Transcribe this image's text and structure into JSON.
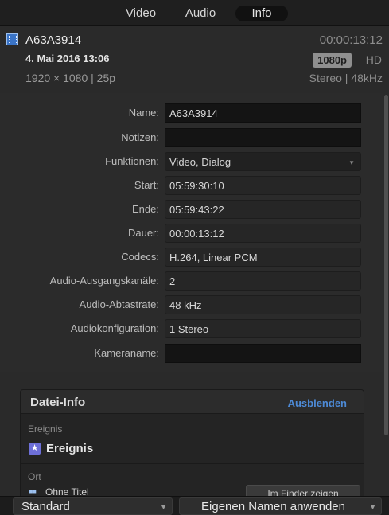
{
  "tabs": [
    {
      "label": "Video",
      "active": false
    },
    {
      "label": "Audio",
      "active": false
    },
    {
      "label": "Info",
      "active": true
    }
  ],
  "clip": {
    "name": "A63A3914",
    "date": "4. Mai 2016 13:06",
    "resolution": "1920 × 1080 | 25p",
    "timecode": "00:00:13:12",
    "format_badge": "1080p",
    "hd_label": "HD",
    "audio_info": "Stereo | 48kHz"
  },
  "fields": [
    {
      "label": "Name:",
      "value": "A63A3914",
      "kind": "edit"
    },
    {
      "label": "Notizen:",
      "value": "",
      "kind": "edit"
    },
    {
      "label": "Funktionen:",
      "value": "Video, Dialog",
      "kind": "dropdown"
    },
    {
      "label": "Start:",
      "value": "05:59:30:10",
      "kind": "readonly"
    },
    {
      "label": "Ende:",
      "value": "05:59:43:22",
      "kind": "readonly"
    },
    {
      "label": "Dauer:",
      "value": "00:00:13:12",
      "kind": "readonly"
    },
    {
      "label": "Codecs:",
      "value": "H.264, Linear PCM",
      "kind": "readonly"
    },
    {
      "label": "Audio-Ausgangskanäle:",
      "value": "2",
      "kind": "readonly"
    },
    {
      "label": "Audio-Abtastrate:",
      "value": "48 kHz",
      "kind": "readonly"
    },
    {
      "label": "Audiokonfiguration:",
      "value": "1 Stereo",
      "kind": "readonly"
    },
    {
      "label": "Kameraname:",
      "value": "",
      "kind": "edit"
    }
  ],
  "file_info": {
    "title": "Datei-Info",
    "hide_label": "Ausblenden",
    "event_label": "Ereignis",
    "event_value": "Ereignis",
    "location_label": "Ort",
    "location_value": "Ohne Titel",
    "finder_button": "Im Finder zeigen"
  },
  "bottom": {
    "preset": "Standard",
    "apply_name": "Eigenen Namen anwenden"
  },
  "colors": {
    "accent_link": "#4d8ad6",
    "clip_icon": "#3a74c7",
    "event_icon": "#6d6fd8"
  }
}
